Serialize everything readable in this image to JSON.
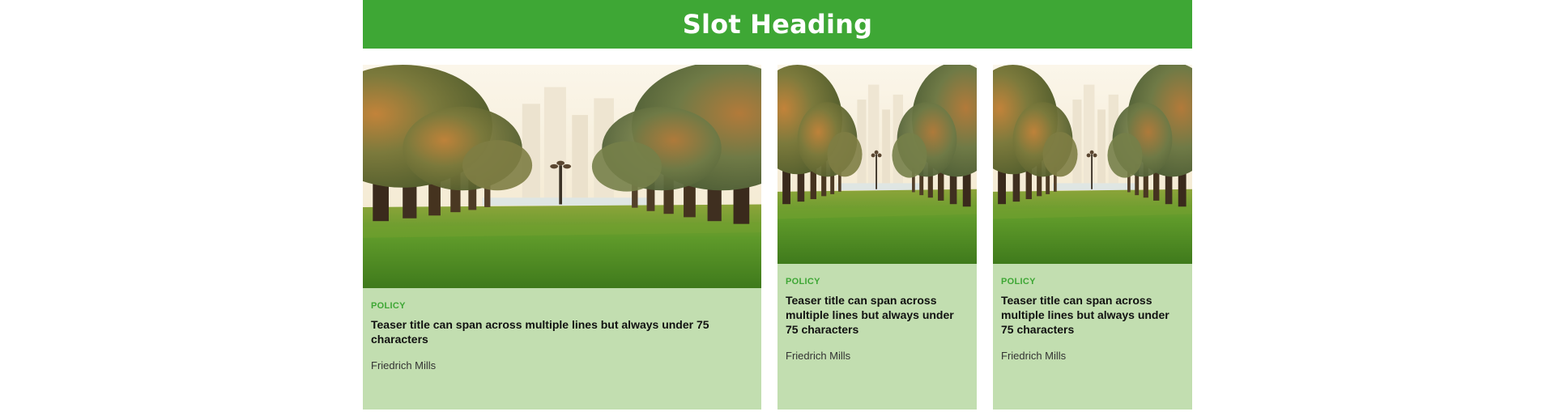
{
  "slot": {
    "heading": "Slot Heading"
  },
  "cards": [
    {
      "category": "POLICY",
      "title": "Teaser title can span across multiple lines but always under 75 characters",
      "author": "Friedrich Mills",
      "image": "palm-avenue-image"
    },
    {
      "category": "POLICY",
      "title": "Teaser title can span across multiple lines but always under 75 characters",
      "author": "Friedrich Mills",
      "image": "palm-avenue-image"
    },
    {
      "category": "POLICY",
      "title": "Teaser title can span across multiple lines but always under 75 characters",
      "author": "Friedrich Mills",
      "image": "palm-avenue-image"
    }
  ],
  "colors": {
    "brand_green": "#3ea735",
    "card_background": "#c2deb0",
    "heading_text": "#ffffff"
  }
}
